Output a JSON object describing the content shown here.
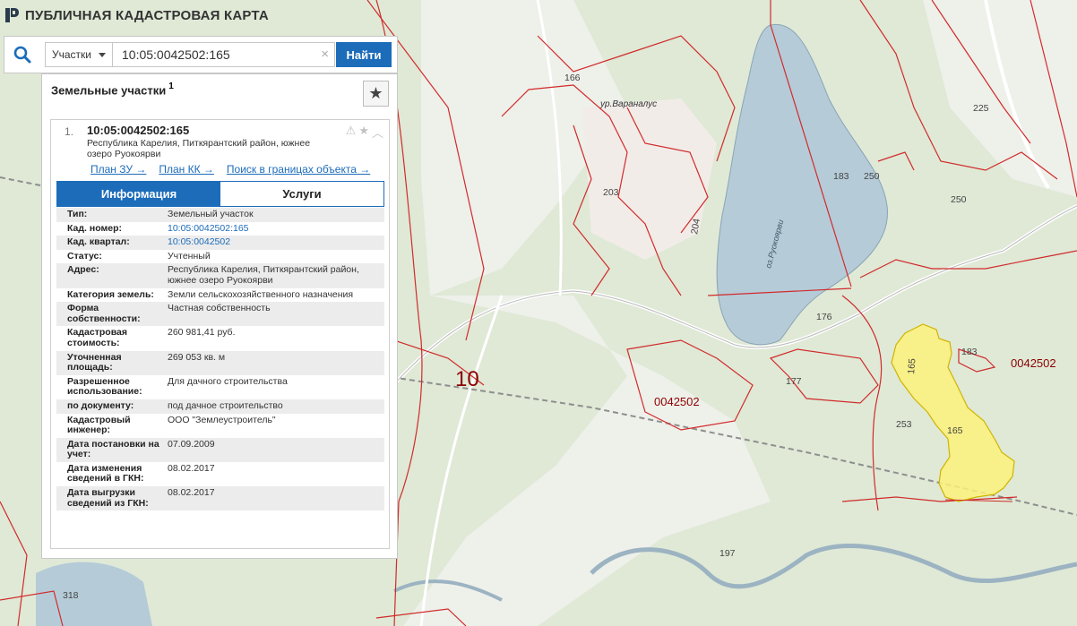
{
  "app": {
    "title": "ПУБЛИЧНАЯ КАДАСТРОВАЯ КАРТА"
  },
  "search": {
    "type_label": "Участки",
    "query": "10:05:0042502:165",
    "clear": "×",
    "button": "Найти"
  },
  "panel": {
    "title": "Земельные участки",
    "count": "1"
  },
  "result": {
    "index": "1.",
    "number": "10:05:0042502:165",
    "address": "Республика Карелия, Питкярантский район, южнее озеро Руокоярви",
    "links": {
      "plan_zu": "План ЗУ →",
      "plan_kk": "План КК →",
      "search_bounds": "Поиск в границах объекта →"
    }
  },
  "tabs": {
    "info": "Информация",
    "services": "Услуги"
  },
  "info": {
    "type_k": "Тип:",
    "type_v": "Земельный участок",
    "cadnum_k": "Кад. номер:",
    "cadnum_v": "10:05:0042502:165",
    "quarter_k": "Кад. квартал:",
    "quarter_v": "10:05:0042502",
    "status_k": "Статус:",
    "status_v": "Учтенный",
    "address_k": "Адрес:",
    "address_v": "Республика Карелия, Питкярантский район, южнее озеро Руокоярви",
    "category_k": "Категория земель:",
    "category_v": "Земли сельскохозяйственного назначения",
    "ownership_k": "Форма собственности:",
    "ownership_v": "Частная собственность",
    "cost_k": "Кадастровая стоимость:",
    "cost_v": "260 981,41 руб.",
    "area_k": "Уточненная площадь:",
    "area_v": "269 053 кв. м",
    "use_k": "Разрешенное использование:",
    "use_v": "Для дачного строительства",
    "bydoc_k": "по документу:",
    "bydoc_v": "под дачное строительство",
    "engineer_k": "Кадастровый инженер:",
    "engineer_v": "ООО \"Землеустроитель\"",
    "regdate_k": "Дата постановки на учет:",
    "regdate_v": "07.09.2009",
    "changedate_k": "Дата изменения сведений в ГКН:",
    "changedate_v": "08.02.2017",
    "exportdate_k": "Дата выгрузки сведений из ГКН:",
    "exportdate_v": "08.02.2017"
  },
  "map": {
    "colors": {
      "land": "#dfe9d6",
      "water": "#b5cbd8",
      "border": "#d12b2b",
      "highlight": "#fdf17a",
      "road": "#ffffff"
    },
    "labels": {
      "district": "10",
      "quarter_a": "0042502",
      "quarter_b": "0042502",
      "place": "ур.Вараналус",
      "lake": "оз.Руокоярви",
      "p166": "166",
      "p225": "225",
      "p183a": "183",
      "p250a": "250",
      "p250b": "250",
      "p203": "203",
      "p204": "204",
      "p176": "176",
      "p183b": "183",
      "p177": "177",
      "p165a": "165",
      "p165b": "165",
      "p253": "253",
      "p197": "197",
      "p318": "318"
    }
  }
}
